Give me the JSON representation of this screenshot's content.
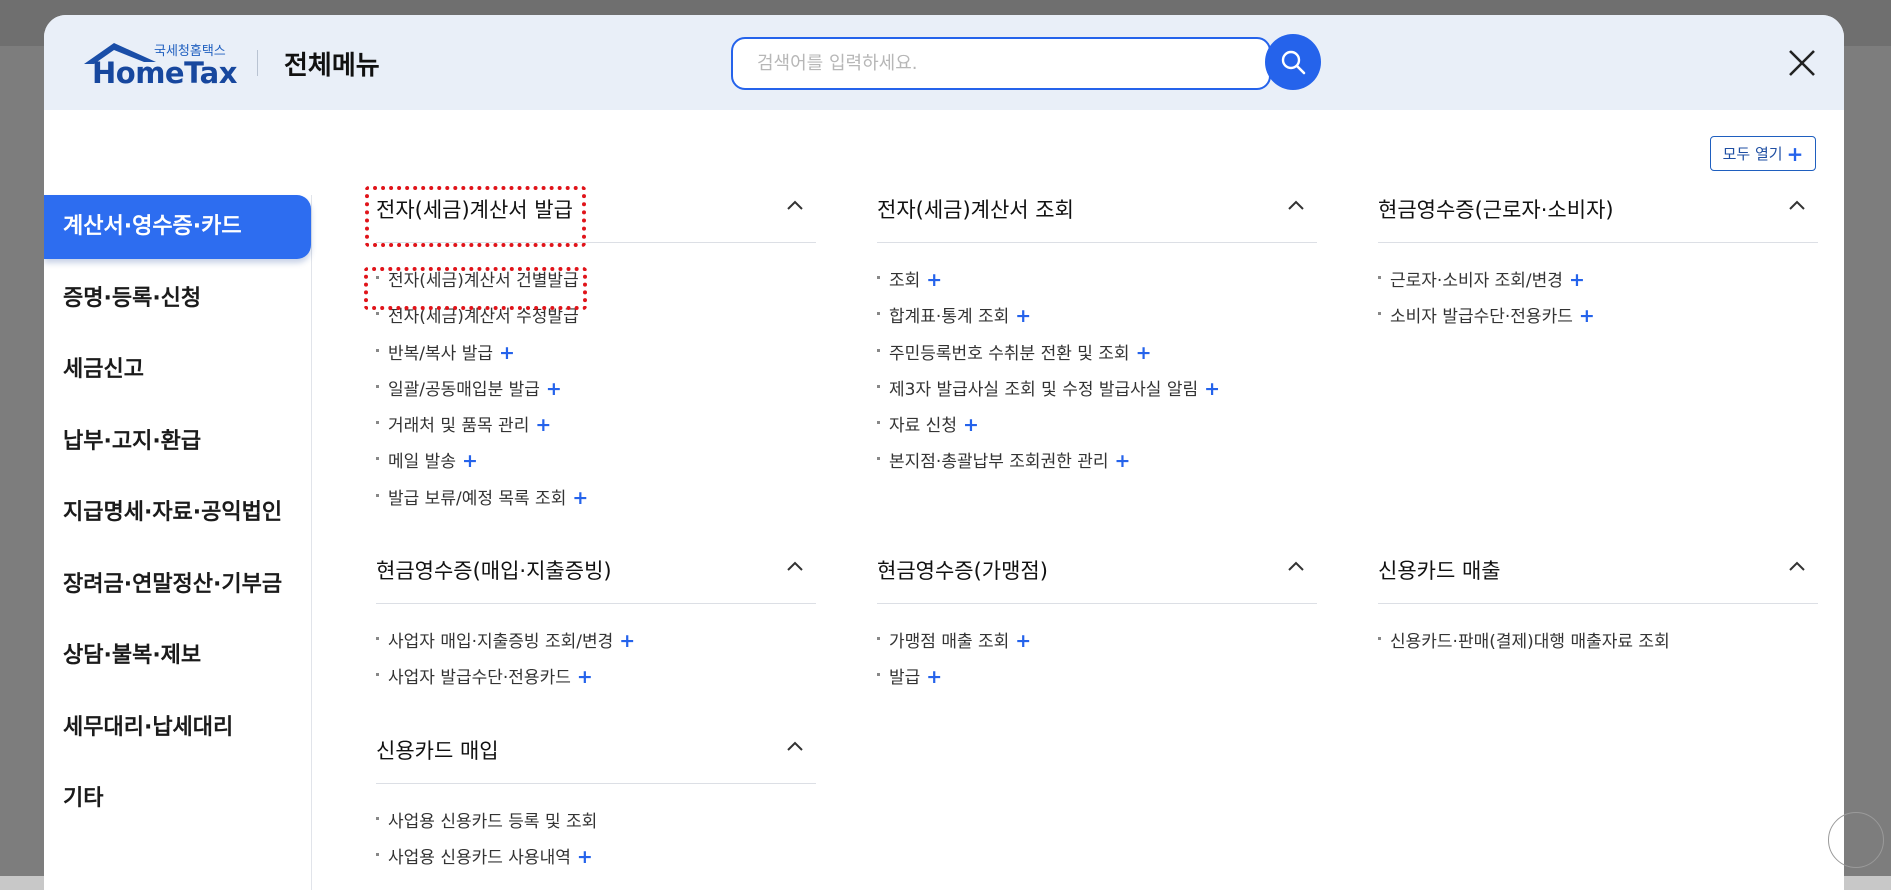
{
  "header": {
    "logo_sub": "국세청홈택스",
    "logo_main": "HomeTax",
    "title": "전체메뉴",
    "search_placeholder": "검색어를 입력하세요."
  },
  "open_all_label": "모두 열기",
  "sidebar": {
    "items": [
      {
        "label": "계산서·영수증·카드",
        "active": true
      },
      {
        "label": "증명·등록·신청"
      },
      {
        "label": "세금신고"
      },
      {
        "label": "납부·고지·환급"
      },
      {
        "label": "지급명세·자료·공익법인"
      },
      {
        "label": "장려금·연말정산·기부금"
      },
      {
        "label": "상담·불복·제보"
      },
      {
        "label": "세무대리·납세대리"
      },
      {
        "label": "기타"
      }
    ]
  },
  "sections": [
    {
      "title": "전자(세금)계산서 발급",
      "items": [
        {
          "label": "전자(세금)계산서 건별발급",
          "plus": false
        },
        {
          "label": "전자(세금)계산서 수정발급",
          "plus": false
        },
        {
          "label": "반복/복사 발급",
          "plus": true
        },
        {
          "label": "일괄/공동매입분 발급",
          "plus": true
        },
        {
          "label": "거래처 및 품목 관리",
          "plus": true
        },
        {
          "label": "메일 발송",
          "plus": true
        },
        {
          "label": "발급 보류/예정 목록 조회",
          "plus": true
        }
      ]
    },
    {
      "title": "전자(세금)계산서 조회",
      "items": [
        {
          "label": "조회",
          "plus": true
        },
        {
          "label": "합계표·통계 조회",
          "plus": true
        },
        {
          "label": "주민등록번호 수취분 전환 및 조회",
          "plus": true
        },
        {
          "label": "제3자 발급사실 조회 및 수정 발급사실 알림",
          "plus": true
        },
        {
          "label": "자료 신청",
          "plus": true
        },
        {
          "label": "본지점·총괄납부 조회권한 관리",
          "plus": true
        }
      ]
    },
    {
      "title": "현금영수증(근로자·소비자)",
      "items": [
        {
          "label": "근로자·소비자 조회/변경",
          "plus": true
        },
        {
          "label": "소비자 발급수단·전용카드",
          "plus": true
        }
      ]
    },
    {
      "title": "현금영수증(매입·지출증빙)",
      "items": [
        {
          "label": "사업자 매입·지출증빙 조회/변경",
          "plus": true
        },
        {
          "label": "사업자 발급수단·전용카드",
          "plus": true
        }
      ]
    },
    {
      "title": "현금영수증(가맹점)",
      "items": [
        {
          "label": "가맹점 매출 조회",
          "plus": true
        },
        {
          "label": "발급",
          "plus": true
        }
      ]
    },
    {
      "title": "신용카드 매출",
      "items": [
        {
          "label": "신용카드·판매(결제)대행 매출자료 조회",
          "plus": false
        }
      ]
    },
    {
      "title": "신용카드 매입",
      "items": [
        {
          "label": "사업용 신용카드 등록 및 조회",
          "plus": false
        },
        {
          "label": "사업용 신용카드 사용내역",
          "plus": true
        }
      ]
    }
  ],
  "colors": {
    "accent": "#2563eb",
    "sidebar_active": "#2d6df0",
    "header_bg": "#e9eff8",
    "highlight": "#e0141a"
  },
  "icons": [
    "home-roof-icon",
    "search-icon",
    "close-icon",
    "chevron-up-icon",
    "plus-icon"
  ]
}
